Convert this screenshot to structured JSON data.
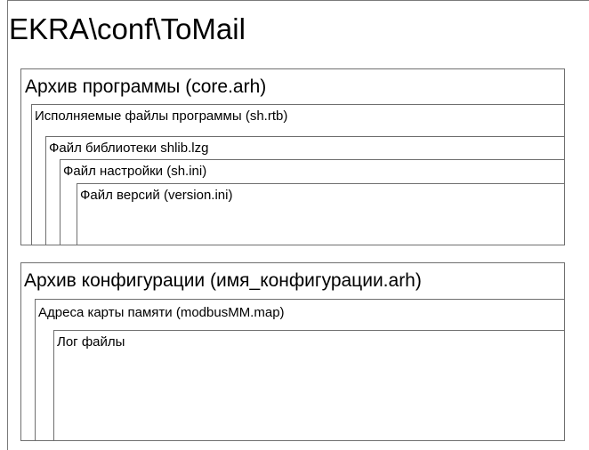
{
  "title": "EKRA\\conf\\ToMail",
  "program_archive": {
    "label": "Архив программы (core.arh)",
    "executables": {
      "label": "Исполняемые файлы программы (sh.rtb)",
      "library": {
        "label": "Файл библиотеки shlib.lzg",
        "settings": {
          "label": "Файл настройки (sh.ini)",
          "versions": {
            "label": "Файл версий (version.ini)"
          }
        }
      }
    }
  },
  "config_archive": {
    "label": "Архив конфигурации (имя_конфигурации.arh)",
    "memory_map": {
      "label": "Адреса карты памяти (modbusMM.map)",
      "logs": {
        "label": "Лог файлы"
      }
    }
  }
}
